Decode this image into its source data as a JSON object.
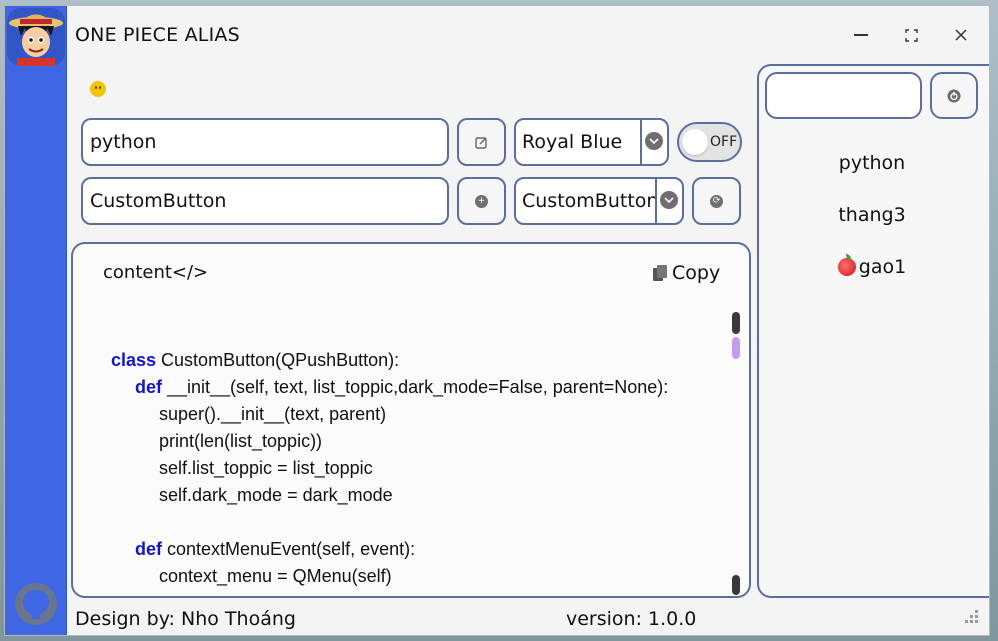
{
  "window": {
    "title": "ONE PIECE ALIAS",
    "buttons": {
      "minimize": "—",
      "maximize": "⛶",
      "close": "✕"
    }
  },
  "toolbar": {
    "row1": {
      "field_value": "python",
      "edit_icon": "edit-icon",
      "theme_select": "Royal Blue",
      "toggle_label": "OFF",
      "toggle_on": false
    },
    "row2": {
      "field_value": "CustomButton",
      "add_icon": "add-icon",
      "class_select": "CustomButton",
      "refresh_icon": "refresh-icon"
    }
  },
  "code_panel": {
    "label": "content</>",
    "copy_label": "Copy",
    "lines": [
      {
        "indent": 0,
        "keyword": "class",
        "text": " CustomButton(QPushButton):"
      },
      {
        "indent": 1,
        "keyword": "def",
        "text": " __init__(self, text, list_toppic,dark_mode=False, parent=None):"
      },
      {
        "indent": 2,
        "keyword": "",
        "text": "super().__init__(text, parent)"
      },
      {
        "indent": 2,
        "keyword": "",
        "text": "print(len(list_toppic))"
      },
      {
        "indent": 2,
        "keyword": "",
        "text": "self.list_toppic = list_toppic"
      },
      {
        "indent": 2,
        "keyword": "",
        "text": "self.dark_mode = dark_mode"
      },
      {
        "indent": 0,
        "keyword": "",
        "text": ""
      },
      {
        "indent": 1,
        "keyword": "def",
        "text": " contextMenuEvent(self, event):"
      },
      {
        "indent": 2,
        "keyword": "",
        "text": "context_menu = QMenu(self)"
      }
    ]
  },
  "right_panel": {
    "search_value": "",
    "power_icon": "power-icon",
    "items": [
      {
        "label": "python",
        "icon": ""
      },
      {
        "label": "thang3",
        "icon": ""
      },
      {
        "label": "gao1",
        "icon": "apple-icon"
      }
    ]
  },
  "footer": {
    "design_by": "Design by: Nho Thoáng",
    "version": "version: 1.0.0"
  },
  "colors": {
    "sidebar": "#3f66e3",
    "border": "#5b6f9e",
    "keyword": "#1414c8",
    "scrollbar_thumb": "#c29cf1"
  }
}
